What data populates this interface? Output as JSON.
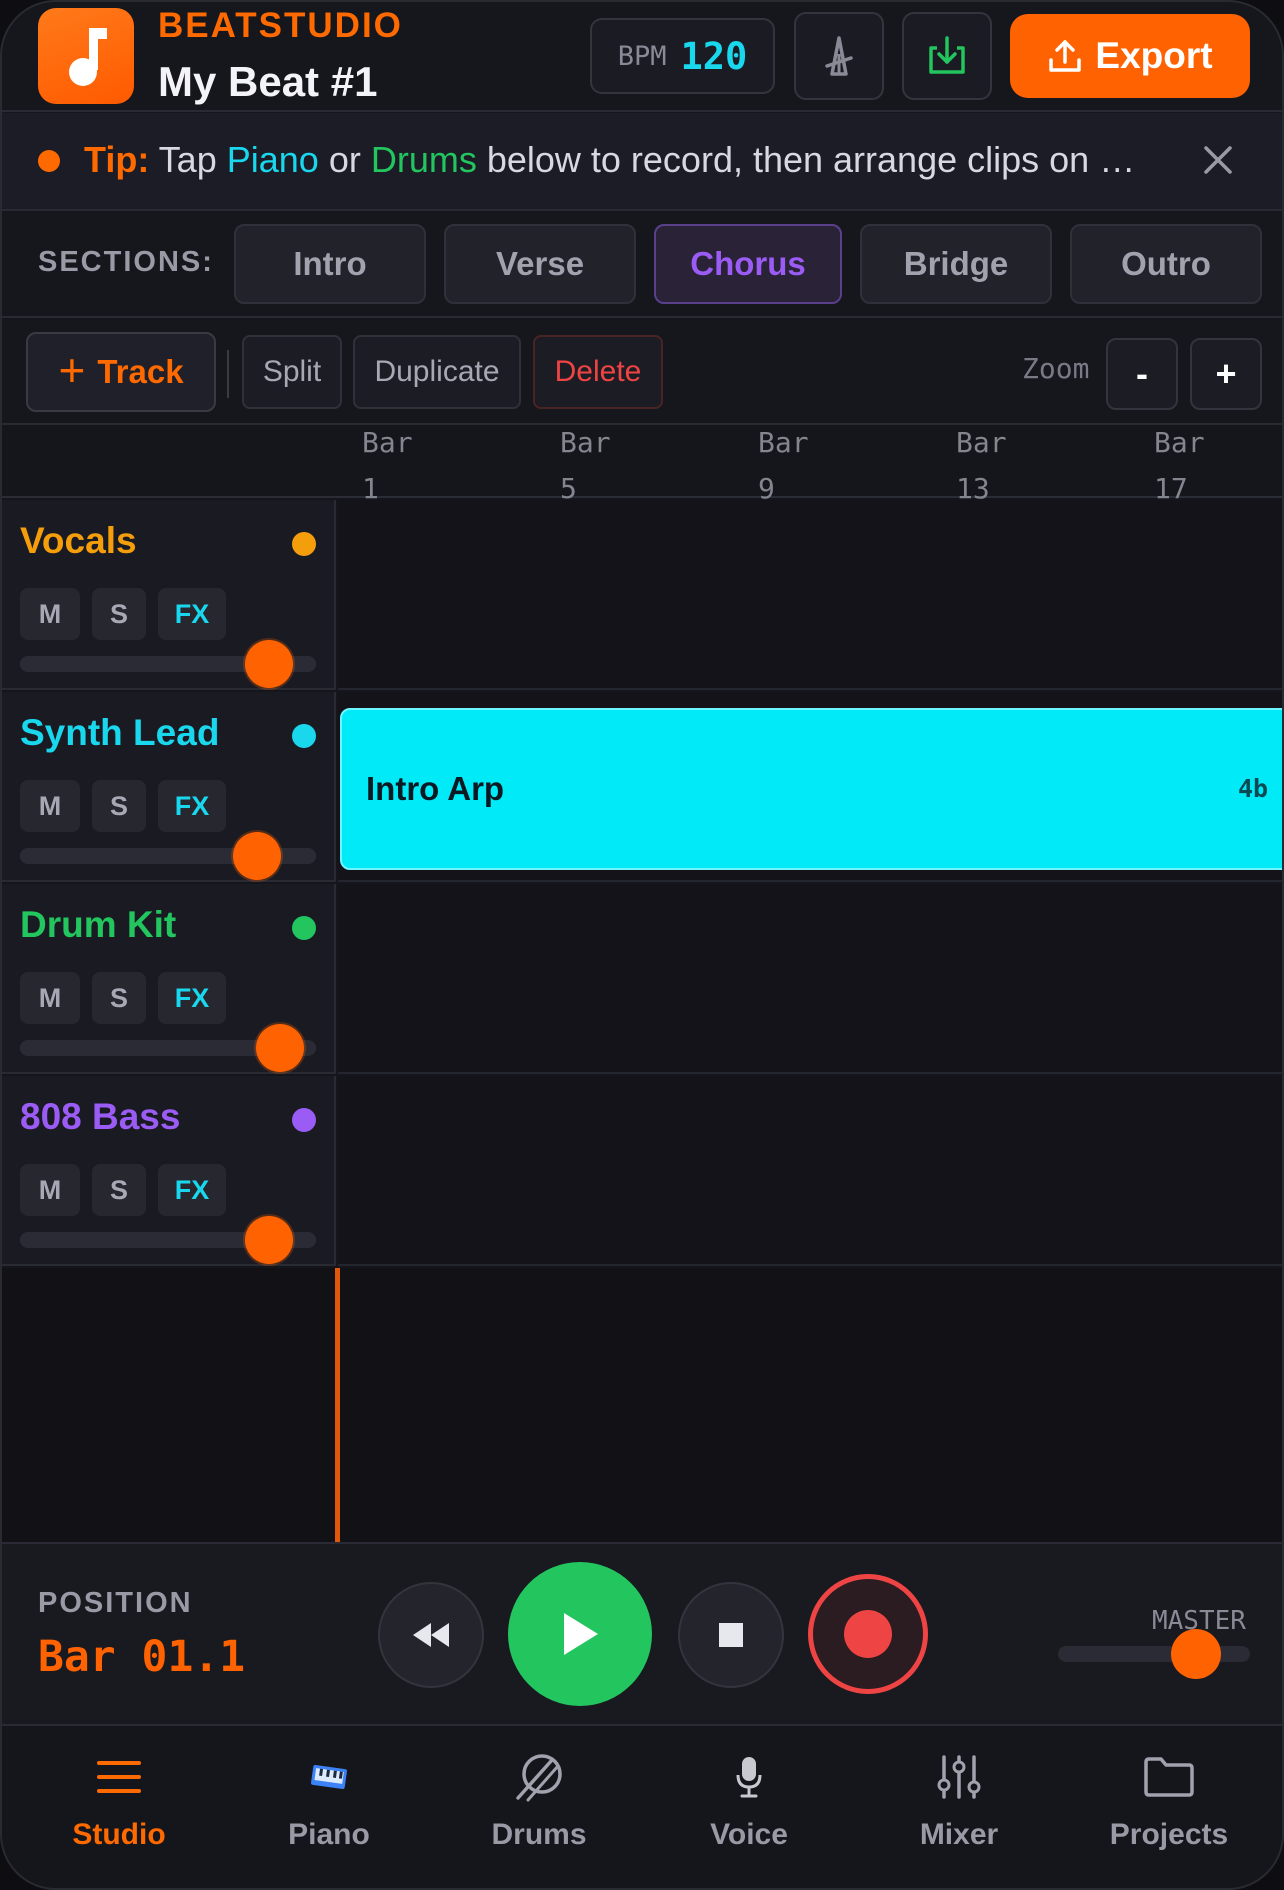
{
  "header": {
    "brand": "BEATSTUDIO",
    "project_title": "My Beat #1",
    "bpm_label": "BPM",
    "bpm_value": "120",
    "export_label": "Export",
    "icons": [
      "music-note-icon",
      "metronome-icon",
      "save-icon",
      "upload-icon"
    ]
  },
  "tip": {
    "prefix": "Tip:",
    "part1": " Tap ",
    "piano": "Piano",
    "part2": " or ",
    "drums": "Drums",
    "part3": " below to record, then arrange clips on t…"
  },
  "sections": {
    "label": "SECTIONS:",
    "items": [
      "Intro",
      "Verse",
      "Chorus",
      "Bridge",
      "Outro"
    ],
    "active": "Chorus"
  },
  "toolbar": {
    "track_label": "Track",
    "split_label": "Split",
    "duplicate_label": "Duplicate",
    "delete_label": "Delete",
    "zoom_label": "Zoom",
    "zoom_out": "-",
    "zoom_in": "+"
  },
  "ruler": [
    {
      "word": "Bar",
      "num": "1"
    },
    {
      "word": "Bar",
      "num": "5"
    },
    {
      "word": "Bar",
      "num": "9"
    },
    {
      "word": "Bar",
      "num": "13"
    },
    {
      "word": "Bar",
      "num": "17"
    }
  ],
  "tracks": [
    {
      "name": "Vocals",
      "color": "#f59e0b",
      "mute": "M",
      "solo": "S",
      "fx": "FX",
      "volume": 0.84
    },
    {
      "name": "Synth Lead",
      "color": "#19d8ee",
      "mute": "M",
      "solo": "S",
      "fx": "FX",
      "volume": 0.8
    },
    {
      "name": "Drum Kit",
      "color": "#22c55e",
      "mute": "M",
      "solo": "S",
      "fx": "FX",
      "volume": 0.88
    },
    {
      "name": "808 Bass",
      "color": "#9b5cf6",
      "mute": "M",
      "solo": "S",
      "fx": "FX",
      "volume": 0.84
    }
  ],
  "clips": [
    {
      "track": "Synth Lead",
      "name": "Intro Arp",
      "length": "4b",
      "color": "#00eaf8"
    }
  ],
  "transport": {
    "position_label": "POSITION",
    "position_value": "Bar 01.1",
    "master_label": "MASTER",
    "master_volume": 0.72
  },
  "nav": {
    "items": [
      {
        "label": "Studio",
        "icon": "menu-icon"
      },
      {
        "label": "Piano",
        "icon": "keyboard-icon"
      },
      {
        "label": "Drums",
        "icon": "drum-icon"
      },
      {
        "label": "Voice",
        "icon": "microphone-icon"
      },
      {
        "label": "Mixer",
        "icon": "sliders-icon"
      },
      {
        "label": "Projects",
        "icon": "folder-icon"
      }
    ],
    "active": "Studio"
  },
  "colors": {
    "accent": "#ff6200",
    "cyan": "#19d8ee",
    "green": "#22c55e",
    "purple": "#9b5cf6",
    "red": "#ef4444"
  }
}
